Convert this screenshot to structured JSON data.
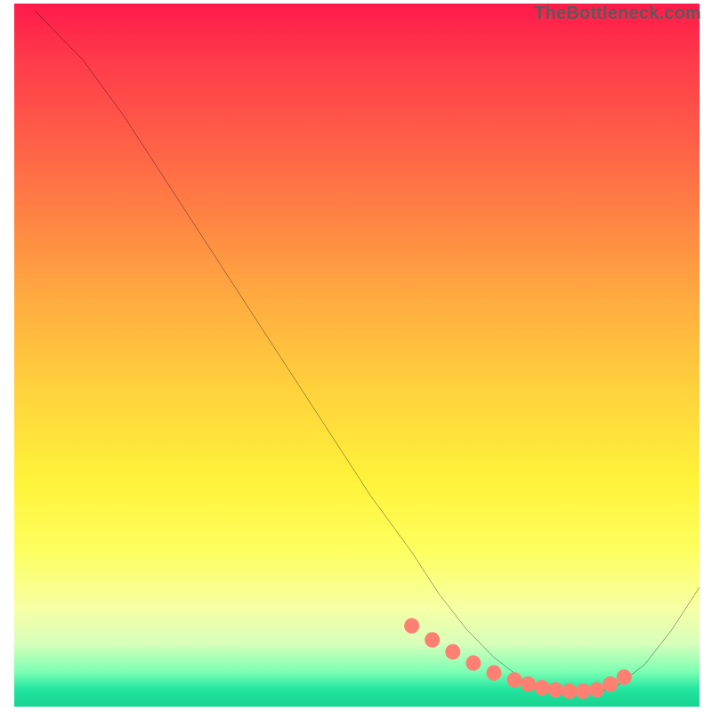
{
  "watermark": "TheBottleneck.com",
  "chart_data": {
    "type": "line",
    "title": "",
    "xlabel": "",
    "ylabel": "",
    "xlim": [
      0,
      100
    ],
    "ylim": [
      0,
      100
    ],
    "grid": false,
    "legend": false,
    "series": [
      {
        "name": "curve",
        "color": "#000000",
        "x": [
          3,
          10,
          16,
          22,
          28,
          34,
          40,
          46,
          52,
          58,
          62,
          66,
          70,
          74,
          76,
          78,
          80,
          82,
          84,
          86,
          88,
          92,
          96,
          100
        ],
        "values": [
          99,
          92,
          84,
          75,
          66,
          57,
          48,
          39,
          30,
          22,
          16,
          11,
          7,
          4,
          3,
          2.5,
          2.2,
          2.0,
          2.0,
          2.3,
          3.0,
          6.0,
          11,
          17
        ]
      }
    ],
    "markers": {
      "color": "#ff7f72",
      "radius": 1.1,
      "x": [
        58,
        61,
        64,
        67,
        70,
        73,
        75,
        77,
        79,
        81,
        83,
        85,
        87,
        89
      ],
      "values": [
        11.5,
        9.5,
        7.8,
        6.2,
        4.8,
        3.8,
        3.2,
        2.7,
        2.4,
        2.2,
        2.2,
        2.4,
        3.2,
        4.2
      ]
    }
  }
}
